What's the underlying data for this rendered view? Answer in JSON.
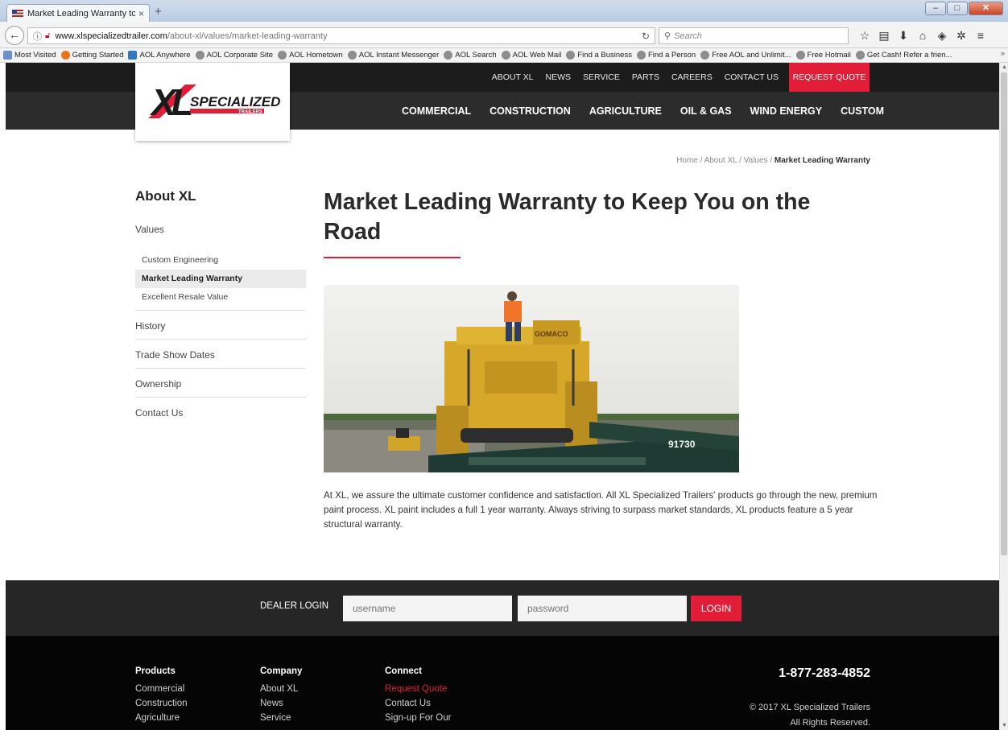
{
  "browser": {
    "tab_title": "Market Leading Warranty to",
    "tab_close": "×",
    "new_tab": "+",
    "url_domain": "www.xlspecializedtrailer.com",
    "url_path": "/about-xl/values/market-leading-warranty",
    "search_placeholder": "Search",
    "bookmarks": [
      "Most Visited",
      "Getting Started",
      "AOL Anywhere",
      "AOL Corporate Site",
      "AOL Hometown",
      "AOL Instant Messenger",
      "AOL Search",
      "AOL Web Mail",
      "Find a Business",
      "Find a Person",
      "Free AOL and Unlimit...",
      "Free Hotmail",
      "Get Cash! Refer a frien..."
    ],
    "bookmarks_more": "»"
  },
  "header": {
    "logo_letters": "XL",
    "logo_word": "SPECIALIZED",
    "logo_sub": "TRAILERS",
    "top_nav": [
      "ABOUT XL",
      "NEWS",
      "SERVICE",
      "PARTS",
      "CAREERS",
      "CONTACT US"
    ],
    "request_quote": "REQUEST QUOTE",
    "main_nav": [
      "COMMERCIAL",
      "CONSTRUCTION",
      "AGRICULTURE",
      "OIL & GAS",
      "WIND ENERGY",
      "CUSTOM"
    ]
  },
  "breadcrumb": {
    "home": "Home",
    "about": "About XL",
    "values": "Values",
    "sep": "/",
    "current": "Market Leading Warranty"
  },
  "sidebar": {
    "title": "About XL",
    "values": "Values",
    "sub_items": [
      "Custom Engineering",
      "Market Leading Warranty",
      "Excellent Resale Value"
    ],
    "items": [
      "History",
      "Trade Show Dates",
      "Ownership",
      "Contact Us"
    ]
  },
  "main": {
    "title": "Market Leading Warranty to Keep You on the Road",
    "photo_machine_label": "GOMACO",
    "photo_trailer_number": "91730",
    "body": "At XL, we assure the ultimate customer confidence and satisfaction. All XL Specialized Trailers' products go through the new, premium paint process. XL paint includes a full 1 year warranty. Always striving to surpass market standards, XL products feature a 5 year structural warranty."
  },
  "dealer": {
    "label": "DEALER LOGIN",
    "username_placeholder": "username",
    "password_placeholder": "password",
    "login": "LOGIN"
  },
  "footer": {
    "products_heading": "Products",
    "products": [
      "Commercial",
      "Construction",
      "Agriculture"
    ],
    "company_heading": "Company",
    "company": [
      "About XL",
      "News",
      "Service"
    ],
    "connect_heading": "Connect",
    "connect": [
      "Request Quote",
      "Contact Us",
      "Sign-up For Our"
    ],
    "phone": "1-877-283-4852",
    "copyright": "© 2017 XL Specialized Trailers",
    "rights": "All Rights Reserved."
  },
  "colors": {
    "brand_red": "#e21d38",
    "topbar": "#1c1c1c",
    "mainbar": "#2c2c2c",
    "footer": "#050505"
  }
}
